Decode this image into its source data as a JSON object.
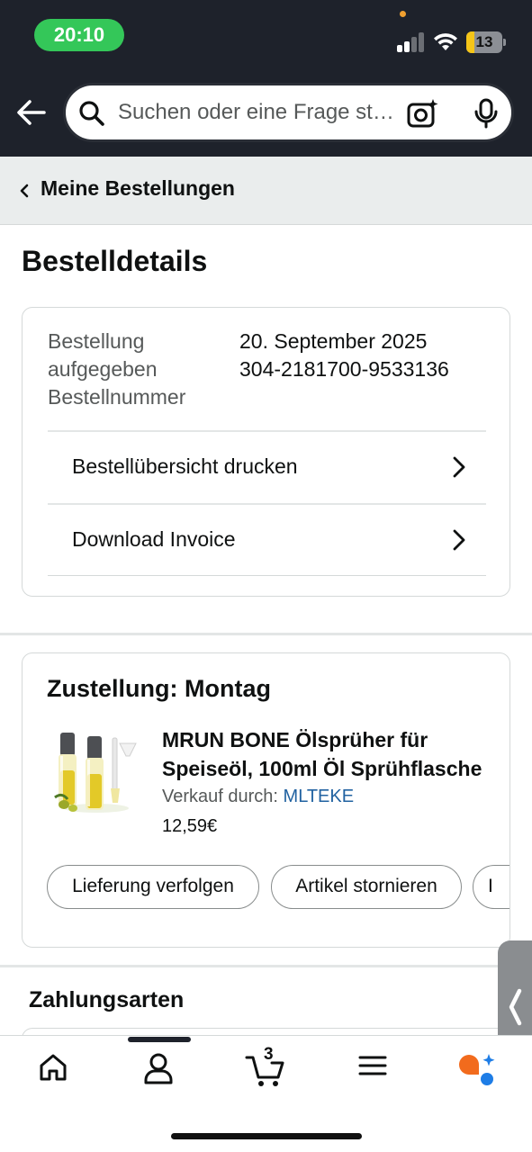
{
  "status_bar": {
    "time": "20:10",
    "battery": "13",
    "battery_level": 0.13
  },
  "header": {
    "search": {
      "placeholder": "Suchen oder eine Frage stellen"
    }
  },
  "breadcrumb": {
    "label": "Meine Bestellungen"
  },
  "page": {
    "title": "Bestelldetails"
  },
  "order": {
    "placed_label": "Bestellung aufgegeben",
    "placed_label_l1": "Bestellung",
    "placed_label_l2": "aufgegeben",
    "placed_value": "20. September 2025",
    "number_label": "Bestellnummer",
    "number_value": "304-2181700-9533136",
    "links": [
      {
        "label": "Bestellübersicht drucken"
      },
      {
        "label": "Download Invoice"
      }
    ]
  },
  "delivery": {
    "title": "Zustellung: Montag",
    "product": {
      "title": "MRUN BONE Ölsprüher für Speiseöl, 100ml Öl Sprühflasche",
      "title_l1": "MRUN BONE Ölsprüher für",
      "title_l2": "Speiseöl, 100ml Öl Sprühflasche",
      "seller_label": "Verkauf durch:",
      "seller_name": "MLTEKE",
      "price": "12,59€"
    },
    "actions": [
      {
        "label": "Lieferung verfolgen"
      },
      {
        "label": "Artikel stornieren"
      },
      {
        "label": "I"
      }
    ]
  },
  "payment": {
    "title": "Zahlungsarten"
  },
  "tabbar": {
    "cart_count": "3"
  },
  "colors": {
    "accent_link": "#2162a1",
    "status_green": "#34c759",
    "header_bg": "#1e222b"
  }
}
